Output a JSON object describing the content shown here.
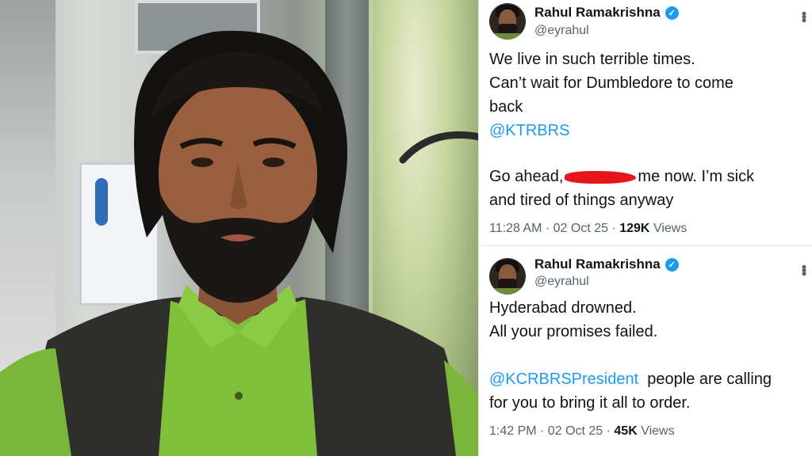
{
  "tweets": [
    {
      "name": "Rahul Ramakrishna",
      "handle": "@eyrahul",
      "more_icon": "more-icon",
      "line1": "We live in such terrible times.",
      "line2": "Can’t wait for Dumbledore to come",
      "line3": "back",
      "mention": "@KTRBRS",
      "line4_pre": "Go ahead,",
      "line4_post": "me now. I’m sick",
      "line5": "and tired of things anyway",
      "time": "11:28 AM · 02 Oct 25 ·",
      "views_count": "129K",
      "views_label": "Views"
    },
    {
      "name": "Rahul Ramakrishna",
      "handle": "@eyrahul",
      "more_icon": "more-icon",
      "line1": "Hyderabad drowned.",
      "line2": "All your promises failed.",
      "mention": "@KCRBRSPresident",
      "line3_post": "people are calling",
      "line4": "for you to bring it all to order.",
      "time": "1:42 PM · 02 Oct 25 ·",
      "views_count": "45K",
      "views_label": "Views"
    }
  ],
  "colors": {
    "link": "#1d9bf0",
    "verified": "#1d9bf0",
    "redaction": "#e6151b",
    "text": "#0f1419",
    "secondary_text": "#536471"
  }
}
